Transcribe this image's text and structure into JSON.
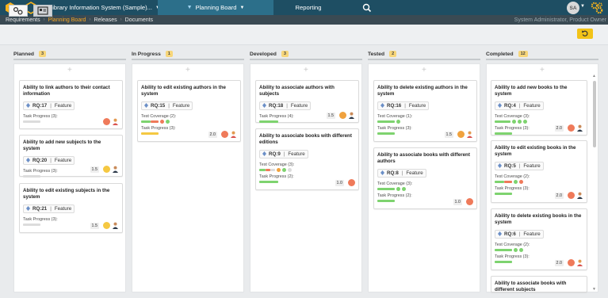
{
  "topbar": {
    "project": "Library Information System (Sample)...",
    "planning": "Planning Board",
    "reporting": "Reporting",
    "avatar": "SA"
  },
  "subnav": {
    "items": [
      "Requirements",
      "Planning Board",
      "Releases",
      "Documents"
    ],
    "user": "System Administrator, Product Owner"
  },
  "columns": [
    {
      "name": "Planned",
      "count": "3"
    },
    {
      "name": "In Progress",
      "count": "1"
    },
    {
      "name": "Developed",
      "count": "3"
    },
    {
      "name": "Tested",
      "count": "2"
    },
    {
      "name": "Completed",
      "count": "12"
    }
  ],
  "cards": {
    "planned": [
      {
        "title": "Ability to link authors to their contact information",
        "id": "RQ:17",
        "type": "Feature",
        "task_label": "Task Progress (3):",
        "estimate": ""
      },
      {
        "title": "Ability to add new subjects to the system",
        "id": "RQ:20",
        "type": "Feature",
        "task_label": "Task Progress (3):",
        "estimate": "1.5"
      },
      {
        "title": "Ability to edit existing subjects in the system",
        "id": "RQ:21",
        "type": "Feature",
        "task_label": "Task Progress (3):",
        "estimate": "1.5"
      }
    ],
    "inprogress": [
      {
        "title": "Ability to edit existing authors in the system",
        "id": "RQ:15",
        "type": "Feature",
        "coverage_label": "Test Coverage (2):",
        "task_label": "Task Progress (3):",
        "estimate": "2.0"
      }
    ],
    "developed": [
      {
        "title": "Ability to associate authors with subjects",
        "id": "RQ:18",
        "type": "Feature",
        "task_label": "Task Progress (4):",
        "estimate": "1.5"
      },
      {
        "title": "Ability to associate books with different editions",
        "id": "RQ:9",
        "type": "Feature",
        "coverage_label": "Test Coverage (3):",
        "task_label": "Task Progress (2):",
        "estimate": "1.0"
      }
    ],
    "tested": [
      {
        "title": "Ability to delete existing authors in the system",
        "id": "RQ:16",
        "type": "Feature",
        "coverage_label": "Test Coverage (1):",
        "task_label": "Task Progress (3):",
        "estimate": "1.5"
      },
      {
        "title": "Ability to associate books with different authors",
        "id": "RQ:8",
        "type": "Feature",
        "coverage_label": "Test Coverage (3):",
        "task_label": "Task Progress (2):",
        "estimate": "1.0"
      }
    ],
    "completed": [
      {
        "title": "Ability to add new books to the system",
        "id": "RQ:4",
        "type": "Feature",
        "coverage_label": "Test Coverage (3):",
        "task_label": "Task Progress (3):",
        "estimate": "2.0"
      },
      {
        "title": "Ability to edit existing books in the system",
        "id": "RQ:5",
        "type": "Feature",
        "coverage_label": "Test Coverage (2):",
        "task_label": "Task Progress (3):",
        "estimate": "2.0"
      },
      {
        "title": "Ability to delete existing books in the system",
        "id": "RQ:6",
        "type": "Feature",
        "coverage_label": "Test Coverage (2):",
        "task_label": "Task Progress (3):",
        "estimate": "2.0"
      },
      {
        "title": "Ability to associate books with different subjects"
      }
    ]
  },
  "colors": {
    "topbar": "#1e4e63",
    "active_tab": "#2c6f8a",
    "accent": "#f6a623",
    "pass": "#7ed36f",
    "fail": "#ef7a5a",
    "caution": "#f5c842"
  }
}
